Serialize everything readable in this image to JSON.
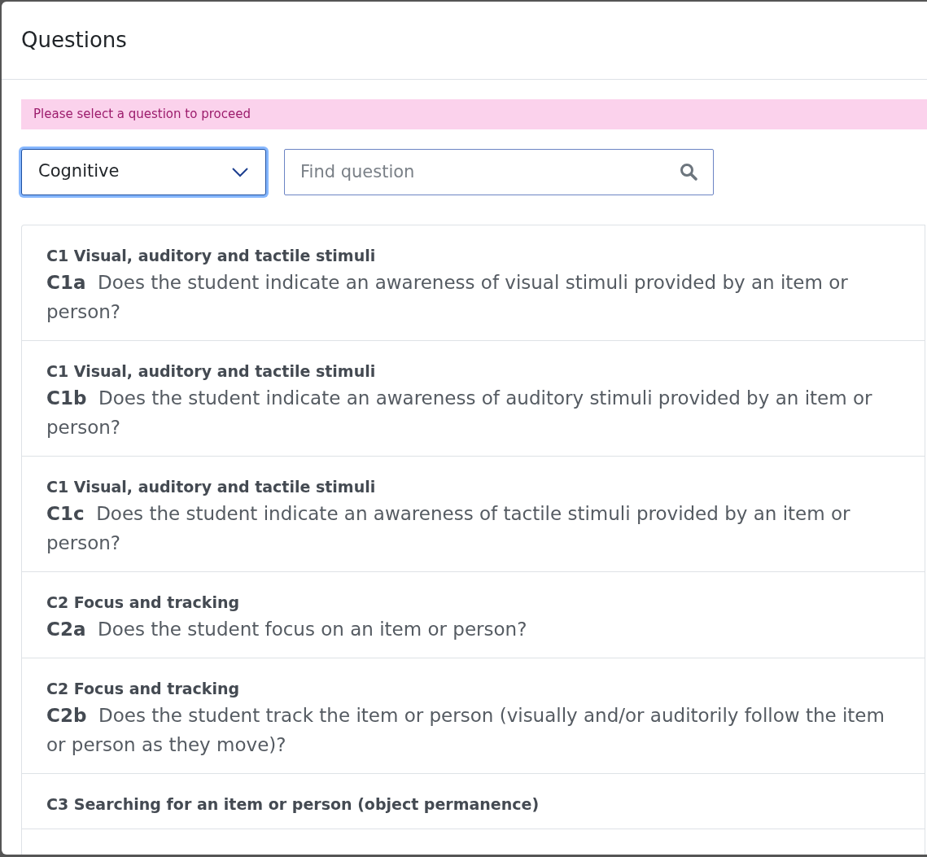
{
  "dialog": {
    "title": "Questions"
  },
  "alert": {
    "text": "Please select a question to proceed"
  },
  "category_select": {
    "value": "Cognitive",
    "focused": true
  },
  "search": {
    "placeholder": "Find question"
  },
  "questions": [
    {
      "heading": "C1 Visual, auditory and tactile stimuli",
      "code": "C1a",
      "text": "Does the student indicate an awareness of visual stimuli provided by an item or person?"
    },
    {
      "heading": "C1 Visual, auditory and tactile stimuli",
      "code": "C1b",
      "text": "Does the student indicate an awareness of auditory stimuli provided by an item or person?"
    },
    {
      "heading": "C1 Visual, auditory and tactile stimuli",
      "code": "C1c",
      "text": "Does the student indicate an awareness of tactile stimuli provided by an item or person?"
    },
    {
      "heading": "C2 Focus and tracking",
      "code": "C2a",
      "text": "Does the student focus on an item or person?"
    },
    {
      "heading": "C2 Focus and tracking",
      "code": "C2b",
      "text": "Does the student track the item or person (visually and/or auditorily follow the item or person as they move)?"
    },
    {
      "heading": "C3 Searching for an item or person (object permanence)"
    }
  ]
}
